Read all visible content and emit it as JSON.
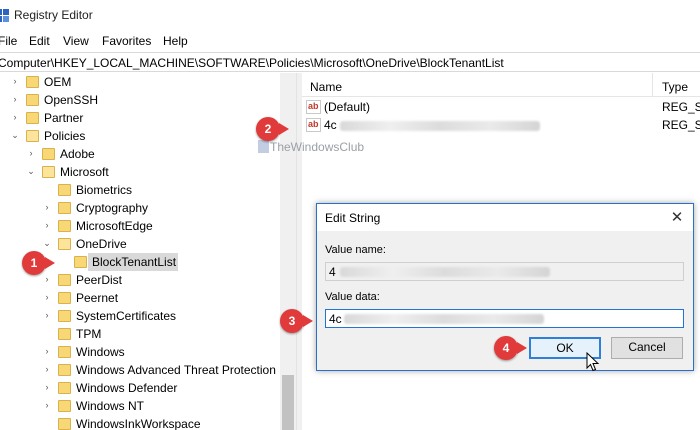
{
  "window": {
    "title": "Registry Editor"
  },
  "menu": [
    "File",
    "Edit",
    "View",
    "Favorites",
    "Help"
  ],
  "address": "Computer\\HKEY_LOCAL_MACHINE\\SOFTWARE\\Policies\\Microsoft\\OneDrive\\BlockTenantList",
  "tree": [
    {
      "label": "OEM",
      "chev": "›"
    },
    {
      "label": "OpenSSH",
      "chev": "›"
    },
    {
      "label": "Partner",
      "chev": "›"
    },
    {
      "label": "Policies",
      "chev": "⌄"
    },
    {
      "label": "Adobe",
      "chev": "›"
    },
    {
      "label": "Microsoft",
      "chev": "⌄"
    },
    {
      "label": "Biometrics",
      "chev": ""
    },
    {
      "label": "Cryptography",
      "chev": "›"
    },
    {
      "label": "MicrosoftEdge",
      "chev": "›"
    },
    {
      "label": "OneDrive",
      "chev": "⌄"
    },
    {
      "label": "BlockTenantList",
      "chev": ""
    },
    {
      "label": "PeerDist",
      "chev": "›"
    },
    {
      "label": "Peernet",
      "chev": "›"
    },
    {
      "label": "SystemCertificates",
      "chev": "›"
    },
    {
      "label": "TPM",
      "chev": ""
    },
    {
      "label": "Windows",
      "chev": "›"
    },
    {
      "label": "Windows Advanced Threat Protection",
      "chev": "›"
    },
    {
      "label": "Windows Defender",
      "chev": "›"
    },
    {
      "label": "Windows NT",
      "chev": "›"
    },
    {
      "label": "WindowsInkWorkspace",
      "chev": ""
    }
  ],
  "list": {
    "columns": {
      "name": "Name",
      "type": "Type"
    },
    "rows": [
      {
        "name": "(Default)",
        "type": "REG_SZ"
      },
      {
        "name": "4c",
        "type": "REG_SZ"
      }
    ]
  },
  "watermark": "TheWindowsClub",
  "dialog": {
    "title": "Edit String",
    "value_name_label": "Value name:",
    "value_name": "4",
    "value_data_label": "Value data:",
    "value_data": "4c",
    "ok_label": "OK",
    "cancel_label": "Cancel",
    "close_glyph": "✕"
  },
  "badges": [
    "1",
    "2",
    "3",
    "4"
  ],
  "colors": {
    "accent": "#2c6fc6",
    "badge": "#e03a3a",
    "folder": "#f8d876"
  }
}
